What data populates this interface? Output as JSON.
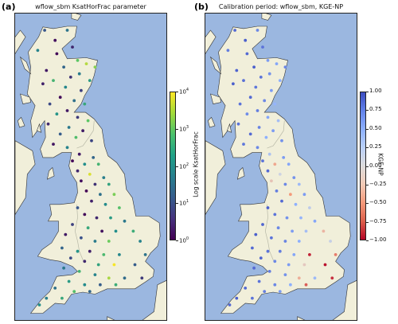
{
  "chart_data": [
    {
      "type": "scatter",
      "panel_letter": "(a)",
      "title": "wflow_sbm KsatHorFrac parameter",
      "colorbar": {
        "label": "Log scale KsatHorFrac",
        "scale": "log",
        "range": [
          1,
          10000
        ],
        "colormap": "viridis",
        "ticks": [
          {
            "base": "10",
            "exp": "0",
            "value": 1
          },
          {
            "base": "10",
            "exp": "1",
            "value": 10
          },
          {
            "base": "10",
            "exp": "2",
            "value": 100
          },
          {
            "base": "10",
            "exp": "3",
            "value": 1000
          },
          {
            "base": "10",
            "exp": "4",
            "value": 10000
          }
        ]
      },
      "points_lon_lat_value": [
        [
          -4.9,
          58.5,
          12
        ],
        [
          -3.6,
          58.5,
          35
        ],
        [
          -4.3,
          58.2,
          1.5
        ],
        [
          -3.3,
          58.0,
          3
        ],
        [
          -5.3,
          57.9,
          60
        ],
        [
          -4.2,
          57.8,
          1.2
        ],
        [
          -3.0,
          57.6,
          900
        ],
        [
          -2.5,
          57.5,
          3500
        ],
        [
          -2.0,
          57.4,
          1800
        ],
        [
          -3.8,
          57.4,
          20
        ],
        [
          -4.8,
          57.3,
          2
        ],
        [
          -2.9,
          57.2,
          45
        ],
        [
          -3.4,
          57.1,
          4
        ],
        [
          -4.4,
          57.0,
          400
        ],
        [
          -2.3,
          57.0,
          150
        ],
        [
          -5.0,
          56.9,
          2.5
        ],
        [
          -3.7,
          56.8,
          70
        ],
        [
          -2.8,
          56.7,
          6
        ],
        [
          -4.0,
          56.5,
          1.3
        ],
        [
          -3.2,
          56.4,
          30
        ],
        [
          -2.6,
          56.3,
          250
        ],
        [
          -4.6,
          56.3,
          8
        ],
        [
          -3.6,
          56.1,
          2
        ],
        [
          -4.2,
          56.0,
          120
        ],
        [
          -3.0,
          55.9,
          5
        ],
        [
          -2.4,
          55.8,
          900
        ],
        [
          -4.7,
          55.7,
          3
        ],
        [
          -3.5,
          55.6,
          40
        ],
        [
          -2.7,
          55.5,
          2.2
        ],
        [
          -4.0,
          55.4,
          15
        ],
        [
          -3.1,
          55.3,
          600
        ],
        [
          -2.2,
          55.2,
          7
        ],
        [
          -4.4,
          55.1,
          1.8
        ],
        [
          -3.6,
          55.0,
          60
        ],
        [
          -2.9,
          54.8,
          2
        ],
        [
          -2.1,
          54.7,
          20
        ],
        [
          -3.3,
          54.6,
          1.2
        ],
        [
          -2.6,
          54.5,
          90
        ],
        [
          -1.8,
          54.5,
          400
        ],
        [
          -3.0,
          54.3,
          3
        ],
        [
          -2.3,
          54.2,
          6000
        ],
        [
          -1.5,
          54.1,
          50
        ],
        [
          -2.8,
          54.0,
          1.5
        ],
        [
          -2.0,
          53.9,
          4
        ],
        [
          -1.2,
          53.9,
          200
        ],
        [
          -2.5,
          53.7,
          1.1
        ],
        [
          -1.7,
          53.6,
          30
        ],
        [
          -0.9,
          53.6,
          1500
        ],
        [
          -2.2,
          53.4,
          2.5
        ],
        [
          -1.4,
          53.3,
          80
        ],
        [
          -3.0,
          53.2,
          12
        ],
        [
          -0.6,
          53.2,
          700
        ],
        [
          -2.6,
          53.0,
          1.3
        ],
        [
          -1.9,
          52.9,
          3
        ],
        [
          -1.1,
          52.9,
          150
        ],
        [
          -0.3,
          52.8,
          40
        ],
        [
          -3.3,
          52.7,
          6
        ],
        [
          -2.4,
          52.6,
          250
        ],
        [
          -1.6,
          52.5,
          1.6
        ],
        [
          -0.8,
          52.5,
          90
        ],
        [
          0.2,
          52.5,
          300
        ],
        [
          -3.7,
          52.4,
          2
        ],
        [
          -2.8,
          52.3,
          10
        ],
        [
          -2.0,
          52.2,
          45
        ],
        [
          -1.2,
          52.2,
          1200
        ],
        [
          0.6,
          52.2,
          60
        ],
        [
          -3.9,
          52.0,
          20
        ],
        [
          -3.0,
          51.9,
          120
        ],
        [
          -2.3,
          51.9,
          2.4
        ],
        [
          -1.5,
          51.8,
          500
        ],
        [
          -0.6,
          51.8,
          70
        ],
        [
          0.9,
          51.8,
          35
        ],
        [
          -3.4,
          51.7,
          8
        ],
        [
          -2.6,
          51.6,
          3
        ],
        [
          -1.8,
          51.5,
          200
        ],
        [
          -0.9,
          51.5,
          9000
        ],
        [
          0.3,
          51.5,
          15
        ],
        [
          -3.8,
          51.4,
          40
        ],
        [
          -2.9,
          51.3,
          400
        ],
        [
          -2.0,
          51.2,
          60
        ],
        [
          -1.2,
          51.1,
          3000
        ],
        [
          -0.3,
          51.1,
          25
        ],
        [
          0.7,
          51.1,
          5
        ],
        [
          -3.5,
          51.0,
          150
        ],
        [
          -2.6,
          50.9,
          80
        ],
        [
          -1.7,
          50.9,
          15
        ],
        [
          -0.8,
          50.9,
          300
        ],
        [
          -4.3,
          50.8,
          30
        ],
        [
          -3.2,
          50.7,
          600
        ],
        [
          -2.3,
          50.7,
          20
        ],
        [
          -4.8,
          50.5,
          50
        ],
        [
          -3.9,
          50.5,
          250
        ],
        [
          -5.2,
          50.3,
          90
        ]
      ]
    },
    {
      "type": "scatter",
      "panel_letter": "(b)",
      "title": "Calibration period: wflow_sbm, KGE-NP",
      "colorbar": {
        "label": "KGE-NP",
        "scale": "linear",
        "range": [
          -1.0,
          1.0
        ],
        "colormap": "coolwarm",
        "ticks": [
          {
            "label": "1.00",
            "value": 1.0
          },
          {
            "label": "0.75",
            "value": 0.75
          },
          {
            "label": "0.50",
            "value": 0.5
          },
          {
            "label": "0.25",
            "value": 0.25
          },
          {
            "label": "0.00",
            "value": 0.0
          },
          {
            "label": "−0.25",
            "value": -0.25
          },
          {
            "label": "−0.50",
            "value": -0.5
          },
          {
            "label": "−0.75",
            "value": -0.75
          },
          {
            "label": "−1.00",
            "value": -1.0
          }
        ]
      },
      "points_lon_lat_value": [
        [
          -4.9,
          58.5,
          0.85
        ],
        [
          -3.6,
          58.5,
          0.7
        ],
        [
          -4.3,
          58.2,
          0.9
        ],
        [
          -3.3,
          58.0,
          0.8
        ],
        [
          -5.3,
          57.9,
          0.75
        ],
        [
          -4.2,
          57.8,
          0.85
        ],
        [
          -3.0,
          57.6,
          0.6
        ],
        [
          -2.5,
          57.5,
          0.55
        ],
        [
          -2.0,
          57.4,
          0.7
        ],
        [
          -3.8,
          57.4,
          0.9
        ],
        [
          -4.8,
          57.3,
          0.88
        ],
        [
          -2.9,
          57.2,
          0.65
        ],
        [
          -3.4,
          57.1,
          0.8
        ],
        [
          -4.4,
          57.0,
          0.82
        ],
        [
          -2.3,
          57.0,
          0.5
        ],
        [
          -5.0,
          56.9,
          0.9
        ],
        [
          -3.7,
          56.8,
          0.78
        ],
        [
          -2.8,
          56.7,
          0.6
        ],
        [
          -4.0,
          56.5,
          0.85
        ],
        [
          -3.2,
          56.4,
          0.7
        ],
        [
          -2.6,
          56.3,
          0.45
        ],
        [
          -4.6,
          56.3,
          0.8
        ],
        [
          -3.6,
          56.1,
          0.75
        ],
        [
          -4.2,
          56.0,
          0.68
        ],
        [
          -3.0,
          55.9,
          0.55
        ],
        [
          -2.4,
          55.8,
          0.35
        ],
        [
          -4.7,
          55.7,
          0.8
        ],
        [
          -3.5,
          55.6,
          0.72
        ],
        [
          -2.7,
          55.5,
          0.6
        ],
        [
          -4.0,
          55.4,
          0.85
        ],
        [
          -3.1,
          55.3,
          0.5
        ],
        [
          -2.2,
          55.2,
          0.65
        ],
        [
          -4.4,
          55.1,
          0.78
        ],
        [
          -3.6,
          55.0,
          0.7
        ],
        [
          -2.9,
          54.8,
          0.3
        ],
        [
          -2.1,
          54.7,
          0.6
        ],
        [
          -3.3,
          54.6,
          0.8
        ],
        [
          -2.6,
          54.5,
          -0.4
        ],
        [
          -1.8,
          54.5,
          0.55
        ],
        [
          -3.0,
          54.3,
          0.85
        ],
        [
          -2.3,
          54.2,
          0.1
        ],
        [
          -1.5,
          54.1,
          0.65
        ],
        [
          -2.8,
          54.0,
          -0.2
        ],
        [
          -2.0,
          53.9,
          0.7
        ],
        [
          -1.2,
          53.9,
          0.4
        ],
        [
          -2.5,
          53.7,
          0.75
        ],
        [
          -1.7,
          53.6,
          -0.5
        ],
        [
          -0.9,
          53.6,
          0.6
        ],
        [
          -2.2,
          53.4,
          0.85
        ],
        [
          -1.4,
          53.3,
          0.5
        ],
        [
          -3.0,
          53.2,
          0.9
        ],
        [
          -0.6,
          53.2,
          0.2
        ],
        [
          -2.6,
          53.0,
          0.8
        ],
        [
          -1.9,
          52.9,
          0.65
        ],
        [
          -1.1,
          52.9,
          0.45
        ],
        [
          -0.3,
          52.8,
          0.55
        ],
        [
          -3.3,
          52.7,
          0.88
        ],
        [
          -2.4,
          52.6,
          0.7
        ],
        [
          -1.6,
          52.5,
          0.6
        ],
        [
          -0.8,
          52.5,
          0.35
        ],
        [
          0.2,
          52.5,
          -0.3
        ],
        [
          -3.7,
          52.4,
          0.9
        ],
        [
          -2.8,
          52.3,
          0.8
        ],
        [
          -2.0,
          52.2,
          0.72
        ],
        [
          -1.2,
          52.2,
          0.5
        ],
        [
          0.6,
          52.2,
          0.15
        ],
        [
          -3.9,
          52.0,
          0.85
        ],
        [
          -3.0,
          51.9,
          0.8
        ],
        [
          -2.3,
          51.9,
          0.75
        ],
        [
          -1.5,
          51.8,
          0.55
        ],
        [
          -0.6,
          51.8,
          -0.9
        ],
        [
          0.9,
          51.8,
          -0.6
        ],
        [
          -3.4,
          51.7,
          0.88
        ],
        [
          -2.6,
          51.6,
          0.7
        ],
        [
          -1.8,
          51.5,
          0.6
        ],
        [
          -0.9,
          51.5,
          -0.15
        ],
        [
          0.3,
          51.5,
          -0.95
        ],
        [
          -3.8,
          51.4,
          0.85
        ],
        [
          -2.9,
          51.3,
          0.75
        ],
        [
          -2.0,
          51.2,
          0.65
        ],
        [
          -1.2,
          51.1,
          -0.35
        ],
        [
          -0.3,
          51.1,
          0.4
        ],
        [
          0.7,
          51.1,
          -0.85
        ],
        [
          -3.5,
          51.0,
          0.8
        ],
        [
          -2.6,
          50.9,
          0.7
        ],
        [
          -1.7,
          50.9,
          0.5
        ],
        [
          -0.8,
          50.9,
          -0.7
        ],
        [
          -4.3,
          50.8,
          0.85
        ],
        [
          -3.2,
          50.7,
          0.75
        ],
        [
          -2.3,
          50.7,
          0.6
        ],
        [
          -4.8,
          50.5,
          0.9
        ],
        [
          -3.9,
          50.5,
          0.8
        ],
        [
          -5.2,
          50.3,
          0.85
        ]
      ]
    }
  ],
  "colors": {
    "sea": "#9bb7e0",
    "land": "#f1efda",
    "coast": "#333333",
    "border": "#b7b8a6"
  }
}
